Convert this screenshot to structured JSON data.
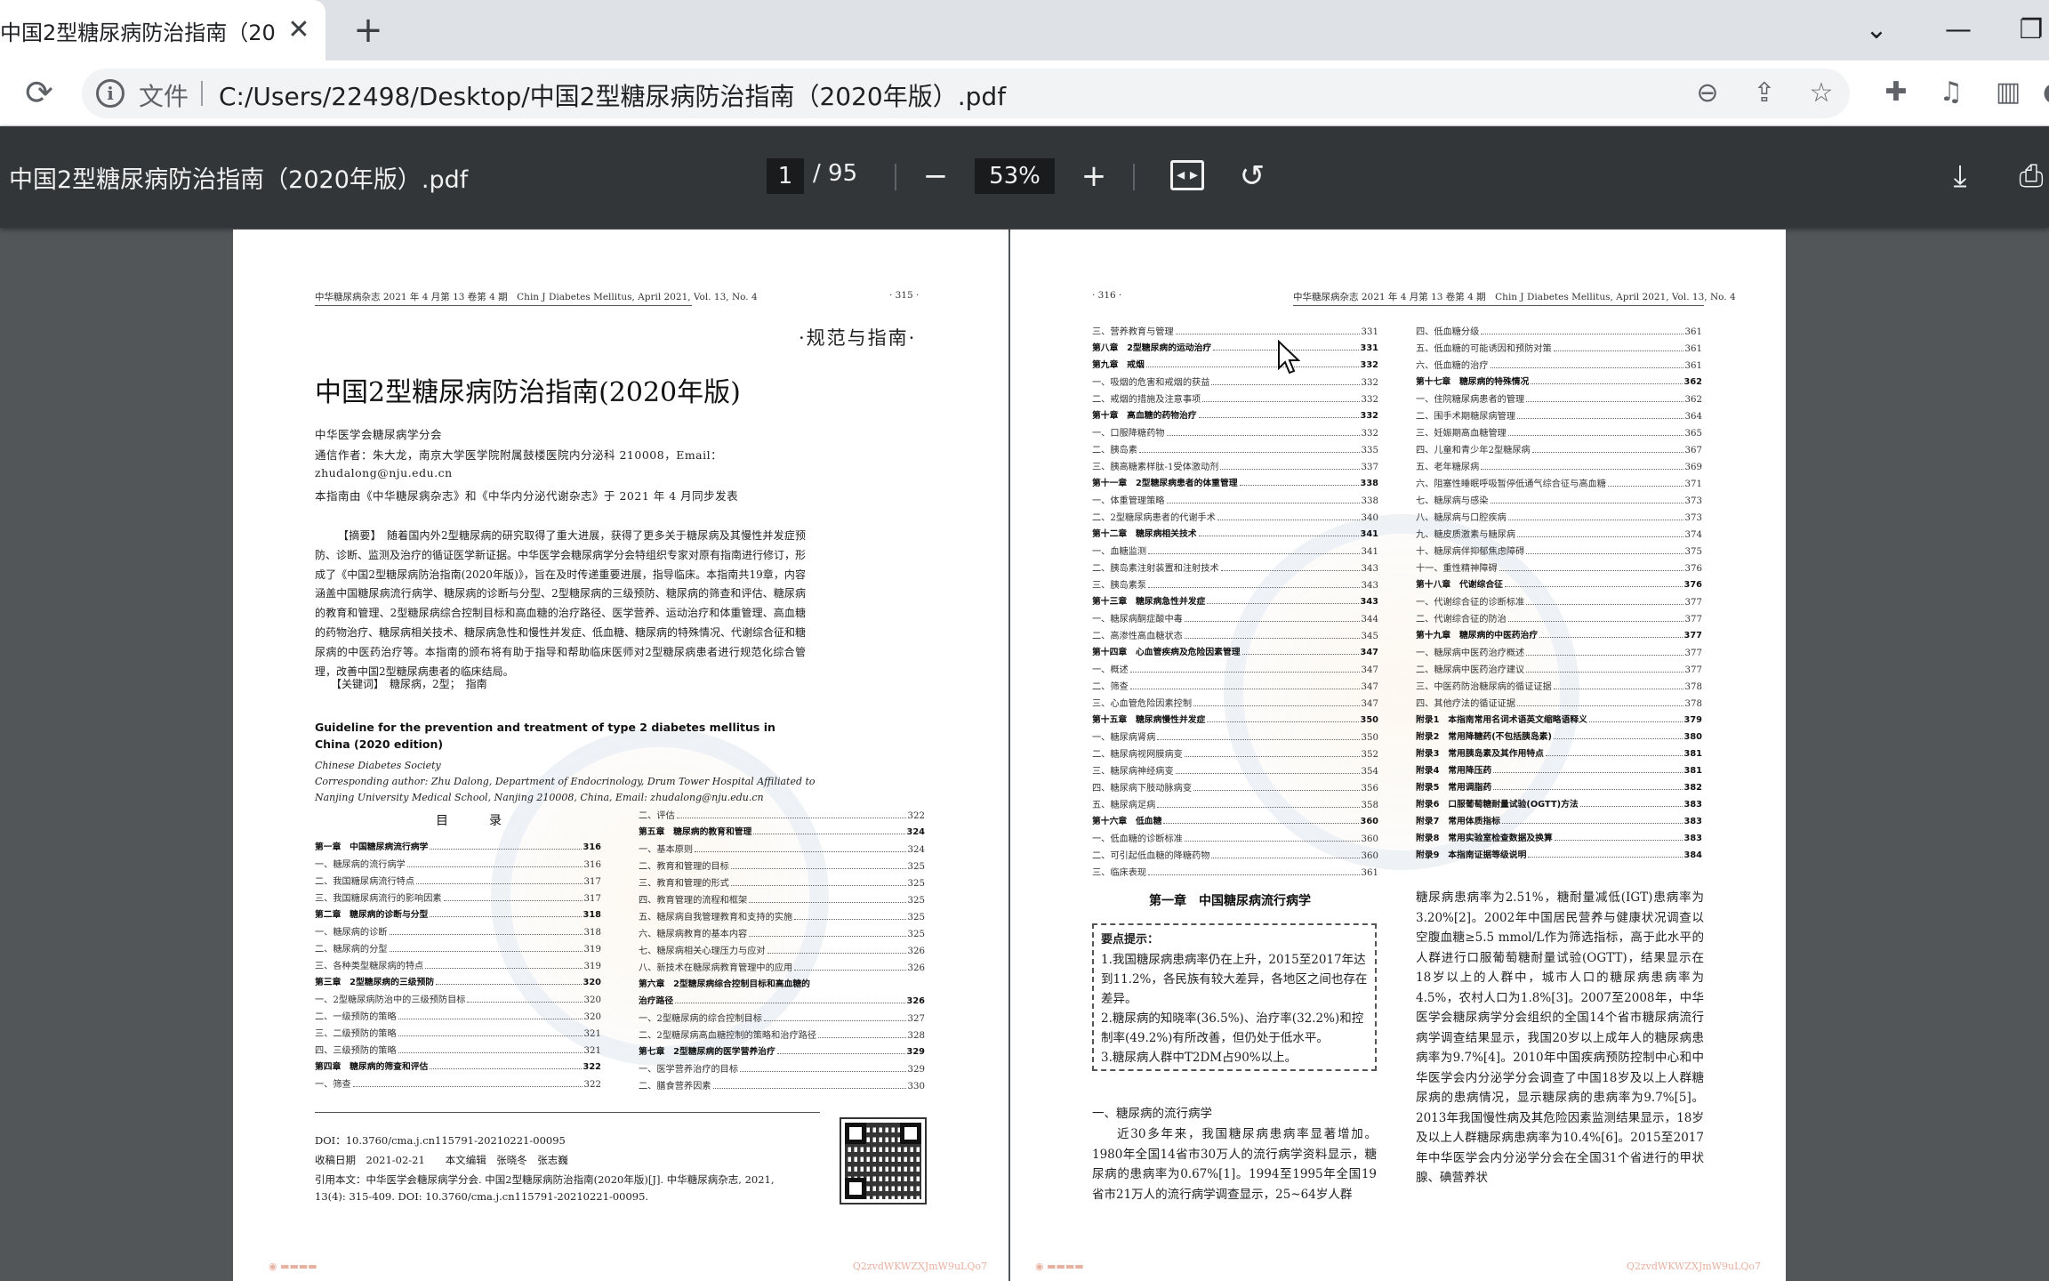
{
  "browser": {
    "tab_title": "中国2型糖尿病防治指南（2020年",
    "tab_close": "✕",
    "new_tab": "+",
    "win_controls": [
      "⌄",
      "—",
      "❐"
    ]
  },
  "address_bar": {
    "scheme_label": "文件",
    "url": "C:/Users/22498/Desktop/中国2型糖尿病防治指南（2020年版）.pdf",
    "icons": [
      "zoom-out-icon",
      "share-icon",
      "star-icon",
      "extensions-icon",
      "media-icon",
      "sidepanel-icon",
      "profile-icon"
    ]
  },
  "pdf_toolbar": {
    "title": "中国2型糖尿病防治指南（2020年版）.pdf",
    "page_current": "1",
    "page_total": "/ 95",
    "zoom": "53%",
    "zoom_out": "−",
    "zoom_in": "+"
  },
  "left_page": {
    "header_left": "中华糖尿病杂志 2021 年 4 月第 13 卷第 4 期　Chin J Diabetes Mellitus, April 2021, Vol. 13, No. 4",
    "header_right": "· 315 ·",
    "section_tag": "·规范与指南·",
    "title": "中国2型糖尿病防治指南(2020年版)",
    "author_org": "中华医学会糖尿病学分会",
    "corresponding": "通信作者：朱大龙，南京大学医学院附属鼓楼医院内分泌科 210008，Email：",
    "email": "zhudalong@nju.edu.cn",
    "publish_note": "本指南由《中华糖尿病杂志》和《中华内分泌代谢杂志》于 2021 年 4 月同步发表",
    "abstract": "【摘要】　随着国内外2型糖尿病的研究取得了重大进展，获得了更多关于糖尿病及其慢性并发症预防、诊断、监测及治疗的循证医学新证据。中华医学会糖尿病学分会特组织专家对原有指南进行修订，形成了《中国2型糖尿病防治指南(2020年版)》，旨在及时传递重要进展，指导临床。本指南共19章，内容涵盖中国糖尿病流行病学、糖尿病的诊断与分型、2型糖尿病的三级预防、糖尿病的筛查和评估、糖尿病的教育和管理、2型糖尿病综合控制目标和高血糖的治疗路径、医学营养、运动治疗和体重管理、高血糖的药物治疗、糖尿病相关技术、糖尿病急性和慢性并发症、低血糖、糖尿病的特殊情况、代谢综合征和糖尿病的中医药治疗等。本指南的颁布将有助于指导和帮助临床医师对2型糖尿病患者进行规范化综合管理，改善中国2型糖尿病患者的临床结局。",
    "keywords": "【关键词】　糖尿病，2型；　指南",
    "en_title": "Guideline for the prevention and treatment of type 2 diabetes mellitus in China (2020 edition)",
    "en_society": "Chinese Diabetes Society",
    "en_author1": "Corresponding author: Zhu Dalong, Department of Endocrinology, Drum Tower Hospital Affiliated to",
    "en_author2": "Nanjing University Medical School, Nanjing 210008, China, Email: zhudalong@nju.edu.cn",
    "toc_heading": "目　录",
    "toc_col1": [
      {
        "label": "第一章　中国糖尿病流行病学",
        "page": "316",
        "chapter": true
      },
      {
        "label": "一、糖尿病的流行病学",
        "page": "316",
        "chapter": false
      },
      {
        "label": "二、我国糖尿病流行特点",
        "page": "317",
        "chapter": false
      },
      {
        "label": "三、我国糖尿病流行的影响因素",
        "page": "317",
        "chapter": false
      },
      {
        "label": "第二章　糖尿病的诊断与分型",
        "page": "318",
        "chapter": true
      },
      {
        "label": "一、糖尿病的诊断",
        "page": "318",
        "chapter": false
      },
      {
        "label": "二、糖尿病的分型",
        "page": "319",
        "chapter": false
      },
      {
        "label": "三、各种类型糖尿病的特点",
        "page": "319",
        "chapter": false
      },
      {
        "label": "第三章　2型糖尿病的三级预防",
        "page": "320",
        "chapter": true
      },
      {
        "label": "一、2型糖尿病防治中的三级预防目标",
        "page": "320",
        "chapter": false
      },
      {
        "label": "二、一级预防的策略",
        "page": "320",
        "chapter": false
      },
      {
        "label": "三、二级预防的策略",
        "page": "321",
        "chapter": false
      },
      {
        "label": "四、三级预防的策略",
        "page": "321",
        "chapter": false
      },
      {
        "label": "第四章　糖尿病的筛查和评估",
        "page": "322",
        "chapter": true
      },
      {
        "label": "一、筛查",
        "page": "322",
        "chapter": false
      }
    ],
    "toc_col2": [
      {
        "label": "二、评估",
        "page": "322",
        "chapter": false
      },
      {
        "label": "第五章　糖尿病的教育和管理",
        "page": "324",
        "chapter": true
      },
      {
        "label": "一、基本原则",
        "page": "324",
        "chapter": false
      },
      {
        "label": "二、教育和管理的目标",
        "page": "325",
        "chapter": false
      },
      {
        "label": "三、教育和管理的形式",
        "page": "325",
        "chapter": false
      },
      {
        "label": "四、教育管理的流程和框架",
        "page": "325",
        "chapter": false
      },
      {
        "label": "五、糖尿病自我管理教育和支持的实施",
        "page": "325",
        "chapter": false
      },
      {
        "label": "六、糖尿病教育的基本内容",
        "page": "325",
        "chapter": false
      },
      {
        "label": "七、糖尿病相关心理压力与应对",
        "page": "326",
        "chapter": false
      },
      {
        "label": "八、新技术在糖尿病教育管理中的应用",
        "page": "326",
        "chapter": false
      },
      {
        "label": "第六章　2型糖尿病综合控制目标和高血糖的",
        "page": "",
        "chapter": true
      },
      {
        "label": "治疗路径",
        "page": "326",
        "chapter": true
      },
      {
        "label": "一、2型糖尿病的综合控制目标",
        "page": "327",
        "chapter": false
      },
      {
        "label": "二、2型糖尿病高血糖控制的策略和治疗路径",
        "page": "328",
        "chapter": false
      },
      {
        "label": "第七章　2型糖尿病的医学营养治疗",
        "page": "329",
        "chapter": true
      },
      {
        "label": "一、医学营养治疗的目标",
        "page": "329",
        "chapter": false
      },
      {
        "label": "二、膳食营养因素",
        "page": "330",
        "chapter": false
      }
    ],
    "doi": "DOI：10.3760/cma.j.cn115791-20210221-00095",
    "received": "收稿日期　2021-02-21　　本文编辑　张晓冬　张志巍",
    "cite1": "引用本文：中华医学会糖尿病学分会. 中国2型糖尿病防治指南(2020年版)[J]. 中华糖尿病杂志, 2021,",
    "cite2": "13(4): 315-409. DOI: 10.3760/cma.j.cn115791-20210221-00095.",
    "bottom_code": "Q2zvdWKWZXJmW9uLQo7"
  },
  "right_page": {
    "header_left": "· 316 ·",
    "header_right": "中华糖尿病杂志 2021 年 4 月第 13 卷第 4 期　Chin J Diabetes Mellitus, April 2021, Vol. 13, No. 4",
    "toc_col1": [
      {
        "label": "三、营养教育与管理",
        "page": "331",
        "chapter": false
      },
      {
        "label": "第八章　2型糖尿病的运动治疗",
        "page": "331",
        "chapter": true
      },
      {
        "label": "第九章　戒烟",
        "page": "332",
        "chapter": true
      },
      {
        "label": "一、吸烟的危害和戒烟的获益",
        "page": "332",
        "chapter": false
      },
      {
        "label": "二、戒烟的措施及注意事项",
        "page": "332",
        "chapter": false
      },
      {
        "label": "第十章　高血糖的药物治疗",
        "page": "332",
        "chapter": true
      },
      {
        "label": "一、口服降糖药物",
        "page": "332",
        "chapter": false
      },
      {
        "label": "二、胰岛素",
        "page": "335",
        "chapter": false
      },
      {
        "label": "三、胰高糖素样肽-1受体激动剂",
        "page": "337",
        "chapter": false
      },
      {
        "label": "第十一章　2型糖尿病患者的体重管理",
        "page": "338",
        "chapter": true
      },
      {
        "label": "一、体重管理策略",
        "page": "338",
        "chapter": false
      },
      {
        "label": "二、2型糖尿病患者的代谢手术",
        "page": "340",
        "chapter": false
      },
      {
        "label": "第十二章　糖尿病相关技术",
        "page": "341",
        "chapter": true
      },
      {
        "label": "一、血糖监测",
        "page": "341",
        "chapter": false
      },
      {
        "label": "二、胰岛素注射装置和注射技术",
        "page": "343",
        "chapter": false
      },
      {
        "label": "三、胰岛素泵",
        "page": "343",
        "chapter": false
      },
      {
        "label": "第十三章　糖尿病急性并发症",
        "page": "343",
        "chapter": true
      },
      {
        "label": "一、糖尿病酮症酸中毒",
        "page": "344",
        "chapter": false
      },
      {
        "label": "二、高渗性高血糖状态",
        "page": "345",
        "chapter": false
      },
      {
        "label": "第十四章　心血管疾病及危险因素管理",
        "page": "347",
        "chapter": true
      },
      {
        "label": "一、概述",
        "page": "347",
        "chapter": false
      },
      {
        "label": "二、筛查",
        "page": "347",
        "chapter": false
      },
      {
        "label": "三、心血管危险因素控制",
        "page": "347",
        "chapter": false
      },
      {
        "label": "第十五章　糖尿病慢性并发症",
        "page": "350",
        "chapter": true
      },
      {
        "label": "一、糖尿病肾病",
        "page": "350",
        "chapter": false
      },
      {
        "label": "二、糖尿病视网膜病变",
        "page": "352",
        "chapter": false
      },
      {
        "label": "三、糖尿病神经病变",
        "page": "354",
        "chapter": false
      },
      {
        "label": "四、糖尿病下肢动脉病变",
        "page": "356",
        "chapter": false
      },
      {
        "label": "五、糖尿病足病",
        "page": "358",
        "chapter": false
      },
      {
        "label": "第十六章　低血糖",
        "page": "360",
        "chapter": true
      },
      {
        "label": "一、低血糖的诊断标准",
        "page": "360",
        "chapter": false
      },
      {
        "label": "二、可引起低血糖的降糖药物",
        "page": "360",
        "chapter": false
      },
      {
        "label": "三、临床表现",
        "page": "361",
        "chapter": false
      }
    ],
    "toc_col2": [
      {
        "label": "四、低血糖分级",
        "page": "361",
        "chapter": false
      },
      {
        "label": "五、低血糖的可能诱因和预防对策",
        "page": "361",
        "chapter": false
      },
      {
        "label": "六、低血糖的治疗",
        "page": "361",
        "chapter": false
      },
      {
        "label": "第十七章　糖尿病的特殊情况",
        "page": "362",
        "chapter": true
      },
      {
        "label": "一、住院糖尿病患者的管理",
        "page": "362",
        "chapter": false
      },
      {
        "label": "二、围手术期糖尿病管理",
        "page": "364",
        "chapter": false
      },
      {
        "label": "三、妊娠期高血糖管理",
        "page": "365",
        "chapter": false
      },
      {
        "label": "四、儿童和青少年2型糖尿病",
        "page": "367",
        "chapter": false
      },
      {
        "label": "五、老年糖尿病",
        "page": "369",
        "chapter": false
      },
      {
        "label": "六、阻塞性睡眠呼吸暂停低通气综合征与高血糖",
        "page": "371",
        "chapter": false
      },
      {
        "label": "七、糖尿病与感染",
        "page": "373",
        "chapter": false
      },
      {
        "label": "八、糖尿病与口腔疾病",
        "page": "373",
        "chapter": false
      },
      {
        "label": "九、糖皮质激素与糖尿病",
        "page": "374",
        "chapter": false
      },
      {
        "label": "十、糖尿病伴抑郁焦虑障碍",
        "page": "375",
        "chapter": false
      },
      {
        "label": "十一、重性精神障碍",
        "page": "376",
        "chapter": false
      },
      {
        "label": "第十八章　代谢综合征",
        "page": "376",
        "chapter": true
      },
      {
        "label": "一、代谢综合征的诊断标准",
        "page": "377",
        "chapter": false
      },
      {
        "label": "二、代谢综合征的防治",
        "page": "377",
        "chapter": false
      },
      {
        "label": "第十九章　糖尿病的中医药治疗",
        "page": "377",
        "chapter": true
      },
      {
        "label": "一、糖尿病中医药治疗概述",
        "page": "377",
        "chapter": false
      },
      {
        "label": "二、糖尿病中医药治疗建议",
        "page": "377",
        "chapter": false
      },
      {
        "label": "三、中医药防治糖尿病的循证证据",
        "page": "378",
        "chapter": false
      },
      {
        "label": "四、其他疗法的循证证据",
        "page": "378",
        "chapter": false
      },
      {
        "label": "附录1　本指南常用名词术语英文缩略语释义",
        "page": "379",
        "chapter": true
      },
      {
        "label": "附录2　常用降糖药(不包括胰岛素)",
        "page": "380",
        "chapter": true
      },
      {
        "label": "附录3　常用胰岛素及其作用特点",
        "page": "381",
        "chapter": true
      },
      {
        "label": "附录4　常用降压药",
        "page": "381",
        "chapter": true
      },
      {
        "label": "附录5　常用调脂药",
        "page": "382",
        "chapter": true
      },
      {
        "label": "附录6　口服葡萄糖耐量试验(OGTT)方法",
        "page": "383",
        "chapter": true
      },
      {
        "label": "附录7　常用体质指标",
        "page": "383",
        "chapter": true
      },
      {
        "label": "附录8　常用实验室检查数据及换算",
        "page": "383",
        "chapter": true
      },
      {
        "label": "附录9　本指南证据等级说明",
        "page": "384",
        "chapter": true
      }
    ],
    "chapter1_title": "第一章　中国糖尿病流行病学",
    "keybox_title": "要点提示：",
    "keybox_items": [
      "1.我国糖尿病患病率仍在上升，2015至2017年达到11.2%，各民族有较大差异，各地区之间也存在差异。",
      "2.糖尿病的知晓率(36.5%)、治疗率(32.2%)和控制率(49.2%)有所改善，但仍处于低水平。",
      "3.糖尿病人群中T2DM占90%以上。"
    ],
    "subhead": "一、糖尿病的流行病学",
    "body_left": "近30多年来，我国糖尿病患病率显著增加。1980年全国14省市30万人的流行病学资料显示，糖尿病的患病率为0.67%[1]。1994至1995年全国19省市21万人的流行病学调查显示，25~64岁人群",
    "body_right": "糖尿病患病率为2.51%，糖耐量减低(IGT)患病率为3.20%[2]。2002年中国居民营养与健康状况调查以空腹血糖≥5.5 mmol/L作为筛选指标，高于此水平的人群进行口服葡萄糖耐量试验(OGTT)，结果显示在18岁以上的人群中，城市人口的糖尿病患病率为4.5%，农村人口为1.8%[3]。2007至2008年，中华医学会糖尿病学分会组织的全国14个省市糖尿病流行病学调查结果显示，我国20岁以上成年人的糖尿病患病率为9.7%[4]。2010年中国疾病预防控制中心和中华医学会内分泌学分会调查了中国18岁及以上人群糖尿病的患病情况，显示糖尿病的患病率为9.7%[5]。2013年我国慢性病及其危险因素监测结果显示，18岁及以上人群糖尿病患病率为10.4%[6]。2015至2017年中华医学会内分泌学分会在全国31个省进行的甲状腺、碘营养状",
    "bottom_code": "Q2zvdWKWZXJmW9uLQo7"
  }
}
